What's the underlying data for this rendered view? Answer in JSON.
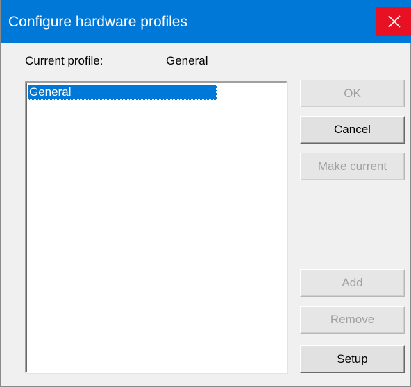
{
  "window": {
    "title": "Configure hardware profiles",
    "accent_color": "#0078d7",
    "close_color": "#e81123"
  },
  "current_profile": {
    "label": "Current profile:",
    "value": "General"
  },
  "profiles": {
    "items": [
      {
        "label": "General",
        "selected": true
      }
    ]
  },
  "buttons": {
    "ok": {
      "label": "OK",
      "enabled": false
    },
    "cancel": {
      "label": "Cancel",
      "enabled": true
    },
    "make_current": {
      "label": "Make current",
      "enabled": false
    },
    "add": {
      "label": "Add",
      "enabled": false
    },
    "remove": {
      "label": "Remove",
      "enabled": false
    },
    "setup": {
      "label": "Setup",
      "enabled": true
    }
  },
  "icons": {
    "close": "close-icon"
  }
}
